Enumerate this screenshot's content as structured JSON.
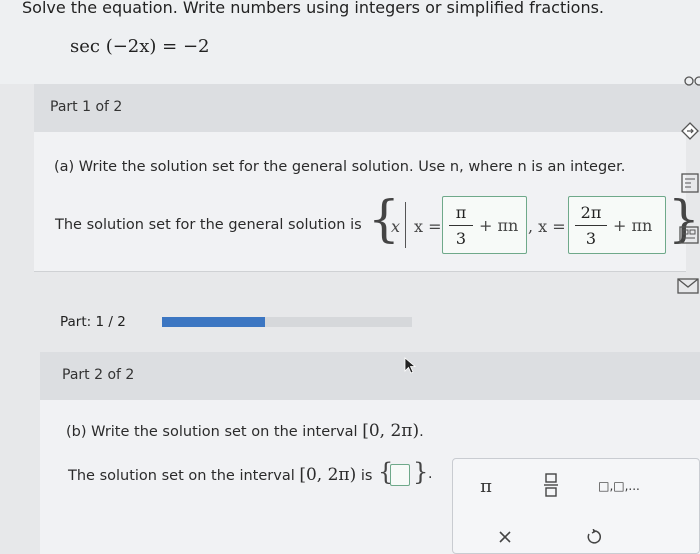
{
  "question": {
    "instruction": "Solve the equation. Write numbers using integers or simplified fractions.",
    "equation": "sec (−2x) = −2"
  },
  "part1": {
    "header": "Part 1 of 2",
    "prompt": "(a) Write the solution set for the general solution. Use n, where n is an integer.",
    "solution_label": "The solution set for the general solution is",
    "set_var": "x",
    "x_eq": "x =",
    "answer1": {
      "num": "π",
      "den": "3",
      "tail": "+ πn"
    },
    "comma_x_eq": ", x =",
    "answer2": {
      "num": "2π",
      "den": "3",
      "tail": "+ πn"
    }
  },
  "progress": {
    "label": "Part: 1 / 2",
    "fraction": 0.41,
    "color": "#3c76c2"
  },
  "part2": {
    "header": "Part 2 of 2",
    "prompt_pre": "(b) Write the solution set on the interval",
    "interval": "[0, 2π)",
    "prompt_post": ".",
    "solution_pre": "The solution set on the interval",
    "solution_mid": "is",
    "solution_post": "."
  },
  "keypad": {
    "keys": [
      "π",
      "fraction-icon",
      "list-icon",
      "clear-icon",
      "undo-icon"
    ],
    "pi_label": "π",
    "list_label": "□,□,..."
  },
  "side_tools": [
    "glasses-icon",
    "eraser-icon",
    "calculator-icon",
    "form-icon",
    "mail-icon"
  ]
}
